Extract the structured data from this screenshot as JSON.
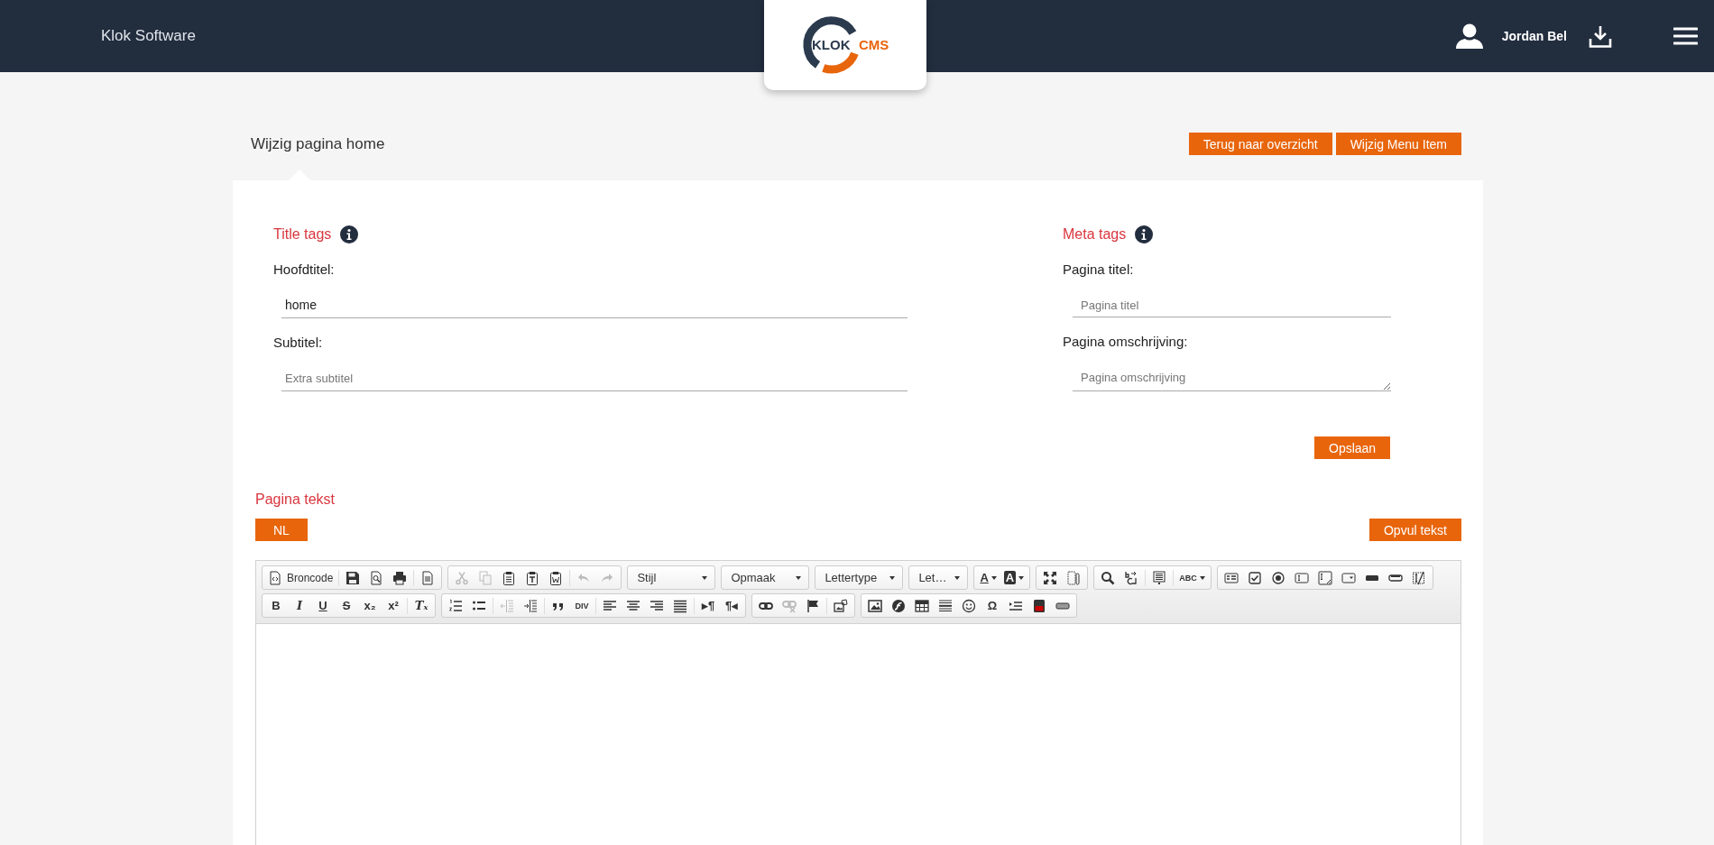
{
  "header": {
    "brand": "Klok Software",
    "logo": {
      "word1": "KLOK",
      "word2": "CMS"
    },
    "user": {
      "name": "Jordan Bel"
    }
  },
  "page": {
    "title": "Wijzig pagina home",
    "buttons": [
      "Terug naar overzicht",
      "Wijzig Menu Item"
    ]
  },
  "title_tags": {
    "heading": "Title tags",
    "fields": [
      {
        "kind": "input",
        "label": "Hoofdtitel:",
        "value": "home"
      },
      {
        "kind": "input",
        "label": "Subtitel:",
        "placeholder": "Extra subtitel"
      }
    ]
  },
  "meta_tags": {
    "heading": "Meta tags",
    "fields": [
      {
        "kind": "input",
        "label": "Pagina titel:",
        "placeholder": "Pagina titel"
      },
      {
        "kind": "textarea",
        "label": "Pagina omschrijving:",
        "placeholder": "Pagina omschrijving"
      }
    ],
    "save_button": "Opslaan"
  },
  "page_text": {
    "heading": "Pagina tekst",
    "language_tabs": [
      "NL"
    ],
    "fill_button": "Opvul tekst"
  },
  "editor": {
    "toolbar": {
      "rows": [
        {
          "groups": [
            {
              "items": [
                {
                  "kind": "labeled",
                  "label": "Broncode"
                },
                {
                  "kind": "separator"
                },
                {
                  "kind": "icon",
                  "disabled": false
                },
                {
                  "kind": "icon",
                  "disabled": false
                },
                {
                  "kind": "icon",
                  "disabled": false
                },
                {
                  "kind": "separator"
                },
                {
                  "kind": "icon",
                  "disabled": false
                }
              ]
            },
            {
              "items": [
                {
                  "kind": "icon",
                  "disabled": true
                },
                {
                  "kind": "icon",
                  "disabled": true
                },
                {
                  "kind": "icon",
                  "disabled": false
                },
                {
                  "kind": "icon",
                  "disabled": false
                },
                {
                  "kind": "icon",
                  "disabled": false
                },
                {
                  "kind": "separator"
                },
                {
                  "kind": "icon",
                  "disabled": true
                },
                {
                  "kind": "icon",
                  "disabled": true
                }
              ]
            },
            {
              "items": [
                {
                  "kind": "dropdown",
                  "label": "Stijl"
                }
              ]
            },
            {
              "items": [
                {
                  "kind": "dropdown",
                  "label": "Opmaak"
                }
              ]
            },
            {
              "items": [
                {
                  "kind": "dropdown",
                  "label": "Lettertype"
                }
              ]
            },
            {
              "items": [
                {
                  "kind": "dropdown",
                  "label": "Let…"
                }
              ]
            },
            {
              "items": [
                {
                  "kind": "colormenu",
                  "label": "A",
                  "disabled": false
                },
                {
                  "kind": "boxmenu",
                  "label": "A",
                  "disabled": false
                }
              ]
            },
            {
              "items": [
                {
                  "kind": "icon",
                  "disabled": false
                },
                {
                  "kind": "icon",
                  "disabled": false
                }
              ]
            },
            {
              "items": [
                {
                  "kind": "icon",
                  "disabled": false
                },
                {
                  "kind": "icon",
                  "disabled": false
                },
                {
                  "kind": "separator"
                },
                {
                  "kind": "icon",
                  "disabled": false
                },
                {
                  "kind": "separator"
                },
                {
                  "kind": "smallmenu",
                  "label": "ABC",
                  "disabled": false
                }
              ]
            },
            {
              "items": [
                {
                  "kind": "icon",
                  "disabled": false
                },
                {
                  "kind": "icon",
                  "disabled": false
                },
                {
                  "kind": "icon",
                  "disabled": false
                },
                {
                  "kind": "icon",
                  "disabled": false
                },
                {
                  "kind": "icon",
                  "disabled": false
                },
                {
                  "kind": "icon",
                  "disabled": false
                },
                {
                  "kind": "icon",
                  "disabled": false
                },
                {
                  "kind": "icon",
                  "disabled": false
                },
                {
                  "kind": "icon",
                  "disabled": false
                }
              ]
            }
          ]
        },
        {
          "groups": [
            {
              "items": [
                {
                  "kind": "glyph",
                  "label": "B",
                  "disabled": false
                },
                {
                  "kind": "italic",
                  "label": "I",
                  "disabled": false
                },
                {
                  "kind": "underline",
                  "label": "U",
                  "disabled": false
                },
                {
                  "kind": "strike",
                  "label": "S",
                  "disabled": false
                },
                {
                  "kind": "glyph",
                  "label": "x₂",
                  "disabled": false
                },
                {
                  "kind": "glyph",
                  "label": "x²",
                  "disabled": false
                },
                {
                  "kind": "separator"
                },
                {
                  "kind": "italic",
                  "label": "Tₓ",
                  "disabled": false
                }
              ]
            },
            {
              "items": [
                {
                  "kind": "icon",
                  "disabled": false
                },
                {
                  "kind": "icon",
                  "disabled": false
                },
                {
                  "kind": "separator"
                },
                {
                  "kind": "icon",
                  "disabled": true
                },
                {
                  "kind": "icon",
                  "disabled": false
                },
                {
                  "kind": "separator"
                },
                {
                  "kind": "icon",
                  "disabled": false
                },
                {
                  "kind": "small",
                  "label": "DIV",
                  "disabled": false
                },
                {
                  "kind": "separator"
                },
                {
                  "kind": "icon",
                  "disabled": false
                },
                {
                  "kind": "icon",
                  "disabled": false
                },
                {
                  "kind": "icon",
                  "disabled": false
                },
                {
                  "kind": "icon",
                  "disabled": false
                },
                {
                  "kind": "separator"
                },
                {
                  "kind": "glyph",
                  "label": "▸¶",
                  "disabled": false
                },
                {
                  "kind": "glyph",
                  "label": "¶◂",
                  "disabled": false
                }
              ]
            },
            {
              "items": [
                {
                  "kind": "icon",
                  "disabled": false
                },
                {
                  "kind": "icon",
                  "disabled": true
                },
                {
                  "kind": "icon",
                  "disabled": false
                },
                {
                  "kind": "separator"
                },
                {
                  "kind": "icon",
                  "disabled": false
                }
              ]
            },
            {
              "items": [
                {
                  "kind": "icon",
                  "disabled": false
                },
                {
                  "kind": "icon",
                  "disabled": false
                },
                {
                  "kind": "icon",
                  "disabled": false
                },
                {
                  "kind": "icon",
                  "disabled": false
                },
                {
                  "kind": "icon",
                  "disabled": false
                },
                {
                  "kind": "glyph",
                  "label": "Ω",
                  "disabled": false
                },
                {
                  "kind": "icon",
                  "disabled": false
                },
                {
                  "kind": "icon",
                  "disabled": false
                },
                {
                  "kind": "icon",
                  "disabled": false
                }
              ]
            }
          ]
        }
      ]
    }
  }
}
